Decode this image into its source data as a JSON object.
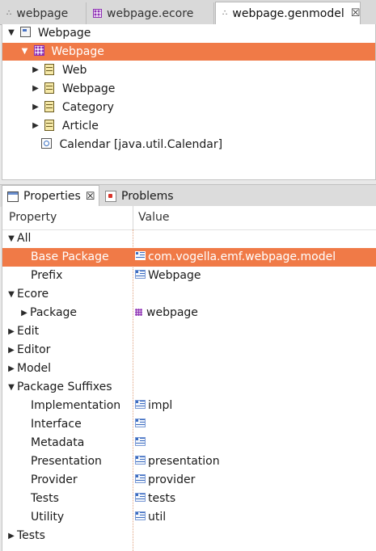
{
  "editor_tabs": [
    {
      "label": "webpage",
      "icon": "genmodel-icon"
    },
    {
      "label": "webpage.ecore",
      "icon": "ecore-icon"
    },
    {
      "label": "webpage.genmodel",
      "icon": "genmodel-icon",
      "active": true,
      "close": "☒"
    }
  ],
  "tree": {
    "root": "Webpage",
    "selected_package": "Webpage",
    "classes": [
      "Web",
      "Webpage",
      "Category",
      "Article"
    ],
    "datatype": "Calendar [java.util.Calendar]"
  },
  "view_tabs": {
    "properties": "Properties",
    "properties_close": "☒",
    "problems": "Problems"
  },
  "properties": {
    "header_property": "Property",
    "header_value": "Value",
    "rows": [
      {
        "label": "All",
        "value": ""
      },
      {
        "label": "Base Package",
        "value": "com.vogella.emf.webpage.model"
      },
      {
        "label": "Prefix",
        "value": "Webpage"
      },
      {
        "label": "Ecore",
        "value": ""
      },
      {
        "label": "Package",
        "value": "webpage"
      },
      {
        "label": "Edit",
        "value": ""
      },
      {
        "label": "Editor",
        "value": ""
      },
      {
        "label": "Model",
        "value": ""
      },
      {
        "label": "Package Suffixes",
        "value": ""
      },
      {
        "label": "Implementation",
        "value": "impl"
      },
      {
        "label": "Interface",
        "value": ""
      },
      {
        "label": "Metadata",
        "value": ""
      },
      {
        "label": "Presentation",
        "value": "presentation"
      },
      {
        "label": "Provider",
        "value": "provider"
      },
      {
        "label": "Tests",
        "value": "tests"
      },
      {
        "label": "Utility",
        "value": "util"
      },
      {
        "label": "Tests",
        "value": ""
      }
    ]
  },
  "colors": {
    "selection": "#f07a47",
    "attribute_icon": "#3c6cc0",
    "ecore_icon": "#8d2fb3"
  }
}
